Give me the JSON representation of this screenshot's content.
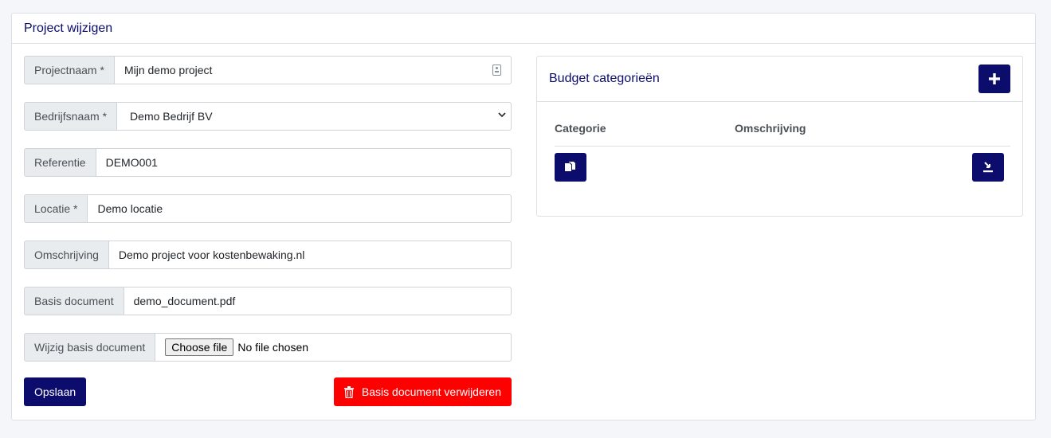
{
  "header": {
    "title": "Project wijzigen"
  },
  "form": {
    "projectnaam": {
      "label": "Projectnaam *",
      "value": "Mijn demo project"
    },
    "bedrijfsnaam": {
      "label": "Bedrijfsnaam *",
      "value": "Demo Bedrijf BV"
    },
    "referentie": {
      "label": "Referentie",
      "value": "DEMO001"
    },
    "locatie": {
      "label": "Locatie *",
      "value": "Demo locatie"
    },
    "omschrijving": {
      "label": "Omschrijving",
      "value": "Demo project voor kostenbewaking.nl"
    },
    "basis_document": {
      "label": "Basis document",
      "value": "demo_document.pdf"
    },
    "wijzig_basis_document": {
      "label": "Wijzig basis document",
      "button": "Choose file",
      "status": "No file chosen"
    }
  },
  "actions": {
    "save": "Opslaan",
    "delete_document": "Basis document verwijderen"
  },
  "budget": {
    "title": "Budget categorieën",
    "columns": [
      "Categorie",
      "Omschrijving"
    ]
  },
  "colors": {
    "primary": "#0b0c6b",
    "danger": "#ff0000"
  },
  "icons": {
    "add": "plus-icon",
    "copy": "copy-icon",
    "import": "import-icon",
    "delete": "trash-icon",
    "contact": "contact-card-icon",
    "dropdown": "chevron-down-icon"
  }
}
